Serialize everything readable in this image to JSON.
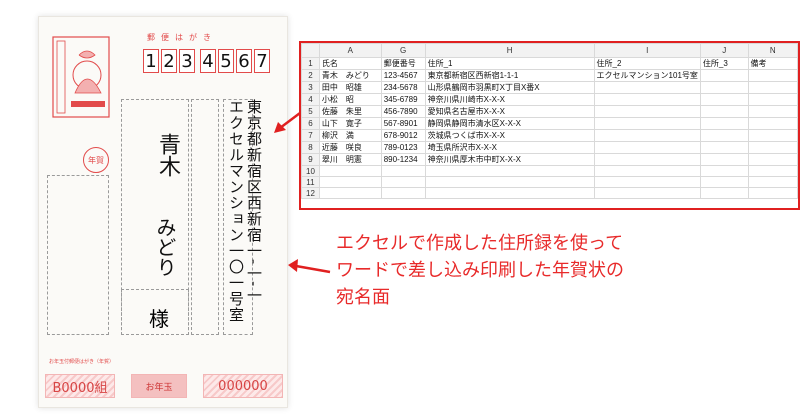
{
  "postcard": {
    "postal_label": "郵便はがき",
    "zip_digits": [
      "1",
      "2",
      "3",
      "4",
      "5",
      "6",
      "7"
    ],
    "address_lines": [
      "東京都新宿区西新宿一-一-一",
      "エクセルマンション一〇一号室"
    ],
    "recipient_surname": "青木",
    "recipient_given": "みどり",
    "honorific": "様",
    "nenga_mark": "年賀",
    "note": "お年玉付郵便はがき（年賀）",
    "lot_group": "B0000組",
    "lot_number": "000000",
    "stamp_brand": "お年玉"
  },
  "spreadsheet": {
    "columns": [
      "",
      "A",
      "G",
      "H",
      "I",
      "J",
      "N"
    ],
    "rows": [
      [
        "1",
        "氏名",
        "郵便番号",
        "住所_1",
        "住所_2",
        "住所_3",
        "備考"
      ],
      [
        "2",
        "青木　みどり",
        "123-4567",
        "東京都新宿区西新宿1-1-1",
        "エクセルマンション101号室",
        "",
        ""
      ],
      [
        "3",
        "田中　昭雄",
        "234-5678",
        "山形県鶴岡市羽黒町X丁目X番X",
        "",
        "",
        ""
      ],
      [
        "4",
        "小松　昭",
        "345-6789",
        "神奈川県川崎市X-X-X",
        "",
        "",
        ""
      ],
      [
        "5",
        "佐藤　朱里",
        "456-7890",
        "愛知県名古屋市X-X-X",
        "",
        "",
        ""
      ],
      [
        "6",
        "山下　寛子",
        "567-8901",
        "静岡県静岡市清水区X-X-X",
        "",
        "",
        ""
      ],
      [
        "7",
        "柳沢　満",
        "678-9012",
        "茨城県つくば市X-X-X",
        "",
        "",
        ""
      ],
      [
        "8",
        "近藤　咲良",
        "789-0123",
        "埼玉県所沢市X-X-X",
        "",
        "",
        ""
      ],
      [
        "9",
        "翠川　明憲",
        "890-1234",
        "神奈川県厚木市中町X-X-X",
        "",
        "",
        ""
      ],
      [
        "10",
        "",
        "",
        "",
        "",
        "",
        ""
      ],
      [
        "11",
        "",
        "",
        "",
        "",
        "",
        ""
      ],
      [
        "12",
        "",
        "",
        "",
        "",
        "",
        ""
      ]
    ]
  },
  "caption": {
    "line1": "エクセルで作成した住所録を使って",
    "line2": "ワードで差し込み印刷した年賀状の",
    "line3": "宛名面"
  },
  "colors": {
    "accent": "#e02020",
    "card_red": "#e24b4b"
  }
}
